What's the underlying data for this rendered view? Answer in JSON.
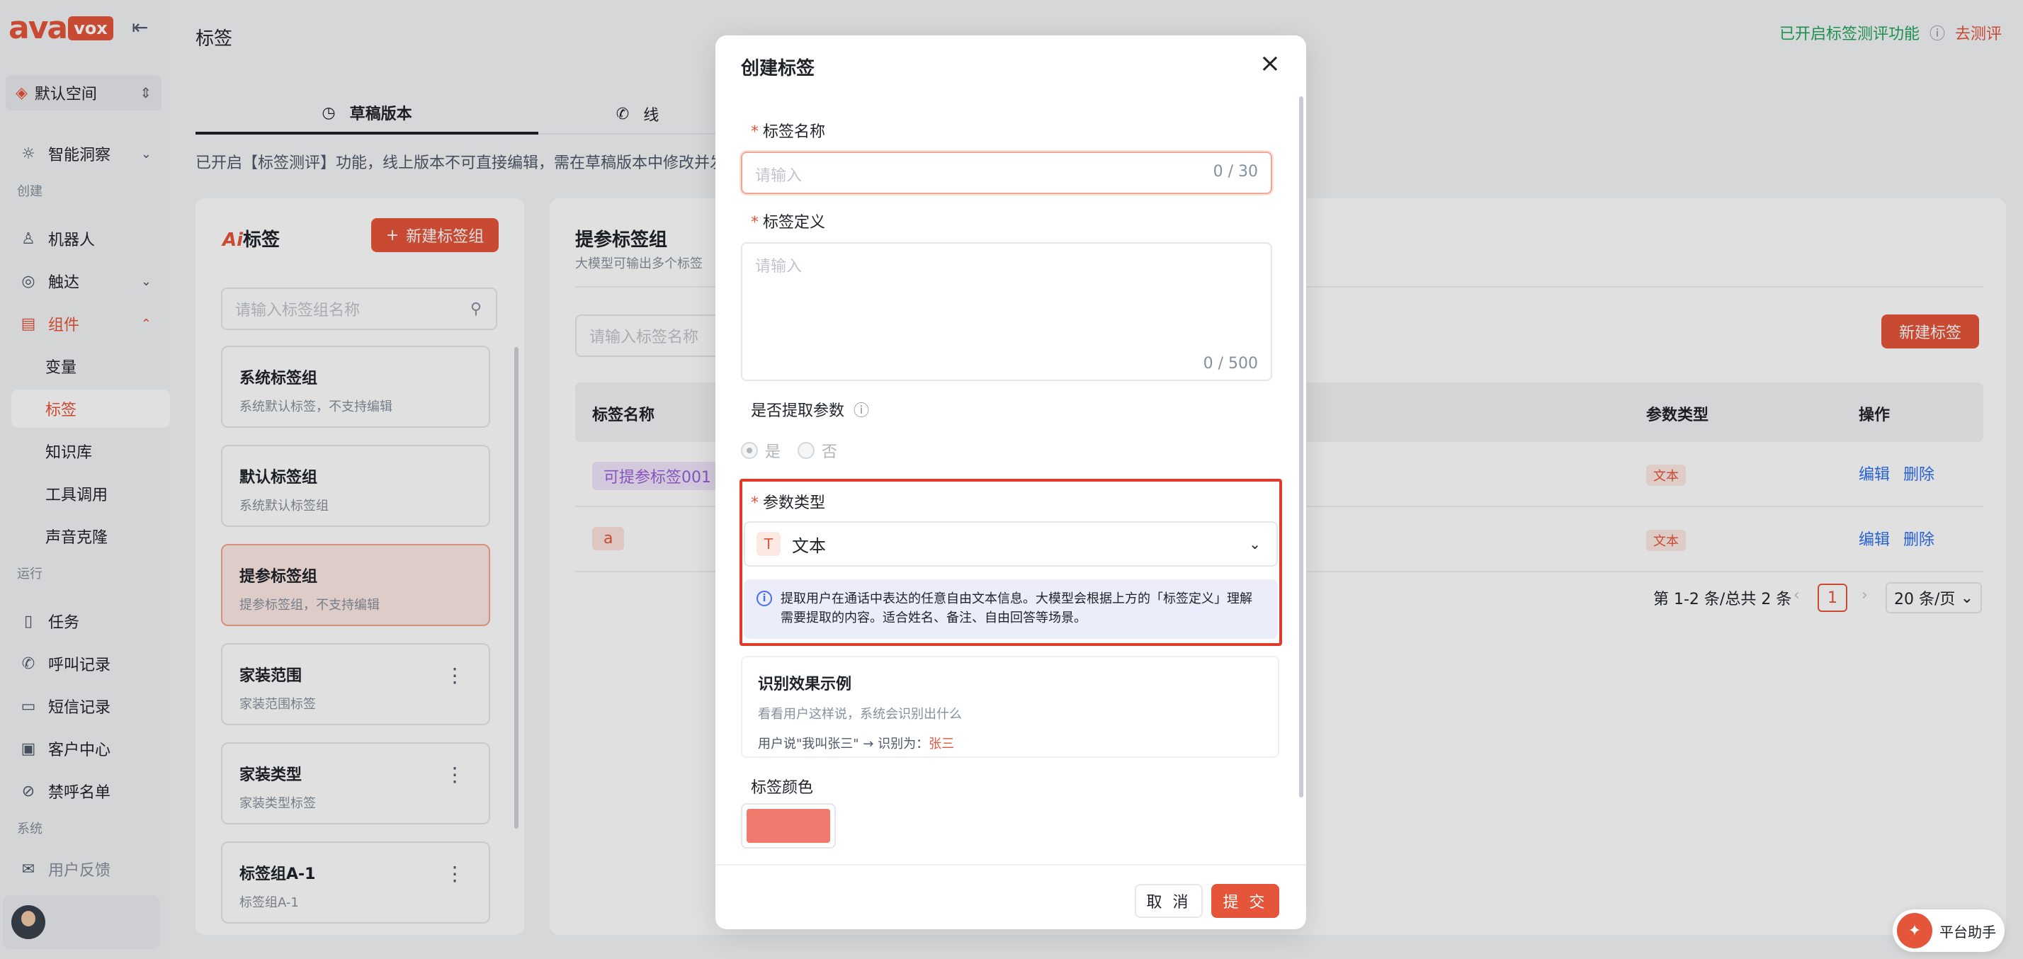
{
  "sidebar": {
    "logo_ava": "ava",
    "logo_vox": "vox",
    "space": "默认空间",
    "insight": "智能洞察",
    "group_create": "创建",
    "robot": "机器人",
    "reach": "触达",
    "components": "组件",
    "variables": "变量",
    "tags": "标签",
    "knowledge": "知识库",
    "tools": "工具调用",
    "voice": "声音克隆",
    "group_run": "运行",
    "tasks": "任务",
    "calls": "呼叫记录",
    "sms": "短信记录",
    "customers": "客户中心",
    "blocklist": "禁呼名单",
    "group_system": "系统",
    "feedback": "用户反馈"
  },
  "header": {
    "title": "标签",
    "eval_status": "已开启标签测评功能",
    "eval_link": "去测评"
  },
  "tabs": {
    "draft": "草稿版本",
    "online": "线"
  },
  "notice": "已开启【标签测评】功能，线上版本不可直接编辑，需在草稿版本中修改并发布",
  "left_panel": {
    "title_ai": "Ai",
    "title": "标签",
    "new_group": "新建标签组",
    "search_placeholder": "请输入标签组名称",
    "groups": [
      {
        "name": "系统标签组",
        "desc": "系统默认标签，不支持编辑"
      },
      {
        "name": "默认标签组",
        "desc": "系统默认标签组"
      },
      {
        "name": "提参标签组",
        "desc": "提参标签组，不支持编辑"
      },
      {
        "name": "家装范围",
        "desc": "家装范围标签"
      },
      {
        "name": "家装类型",
        "desc": "家装类型标签"
      },
      {
        "name": "标签组A-1",
        "desc": "标签组A-1"
      }
    ]
  },
  "right_panel": {
    "title": "提参标签组",
    "subtitle": "大模型可输出多个标签",
    "search_placeholder": "请输入标签名称",
    "new_tag": "新建标签",
    "columns": {
      "name": "标签名称",
      "type": "参数类型",
      "ops": "操作"
    },
    "rows": [
      {
        "name": "可提参标签001",
        "type": "文本",
        "edit": "编辑",
        "delete": "删除"
      },
      {
        "name": "a",
        "type": "文本",
        "edit": "编辑",
        "delete": "删除"
      }
    ],
    "pager": {
      "summary": "第 1-2 条/总共 2 条",
      "page": "1",
      "size": "20 条/页"
    }
  },
  "modal": {
    "title": "创建标签",
    "name_label": "标签名称",
    "name_placeholder": "请输入",
    "name_count": "0 / 30",
    "def_label": "标签定义",
    "def_placeholder": "请输入",
    "def_count": "0 / 500",
    "extract_label": "是否提取参数",
    "yes": "是",
    "no": "否",
    "param_type_label": "参数类型",
    "param_type_value": "文本",
    "param_type_icon": "T",
    "info_line1": "提取用户在通话中表达的任意自由文本信息。大模型会根据上方的「标签定义」理解",
    "info_line2": "需要提取的内容。适合姓名、备注、自由回答等场景。",
    "example_title": "识别效果示例",
    "example_sub": "看看用户这样说，系统会识别出什么",
    "example_text": "用户说\"我叫张三\" → 识别为：",
    "example_value": "张三",
    "color_label": "标签颜色",
    "color_value": "#ef7a6d",
    "cancel": "取 消",
    "submit": "提 交"
  },
  "assistant": "平台助手",
  "colors": {
    "accent": "#e4553a",
    "link": "#2d6ff0",
    "success": "#21a35a",
    "highlight": "#e13a2a"
  }
}
